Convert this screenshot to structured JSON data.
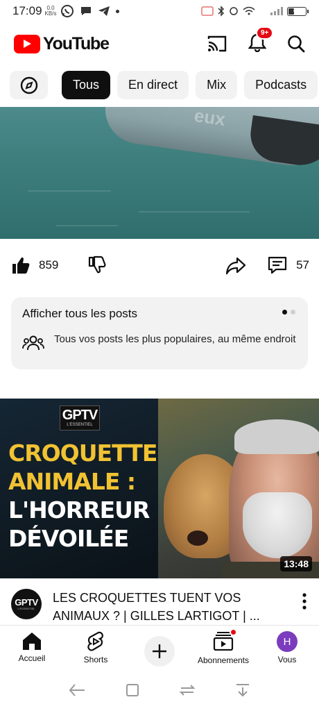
{
  "status_bar": {
    "time": "17:09",
    "net_speed_value": "0.0",
    "net_speed_unit": "KB/s",
    "battery": "6"
  },
  "header": {
    "app_name": "YouTube",
    "notification_badge": "9+"
  },
  "chips": [
    {
      "label": "Tous",
      "selected": true
    },
    {
      "label": "En direct",
      "selected": false
    },
    {
      "label": "Mix",
      "selected": false
    },
    {
      "label": "Podcasts",
      "selected": false
    }
  ],
  "post": {
    "image_overlay_text": "eux",
    "likes": "859",
    "comments": "57"
  },
  "posts_card": {
    "title": "Afficher tous les posts",
    "description": "Tous vos posts les plus populaires, au même endroit"
  },
  "video": {
    "thumbnail_badge_main": "GPTV",
    "thumbnail_badge_sub": "L'ESSENTIEL",
    "headline_line1": "CROQUETTE",
    "headline_line2": "ANIMALE :",
    "headline_line3": "L'HORREUR",
    "headline_line4": "DÉVOILÉE",
    "duration": "13:48",
    "title": "LES CROQUETTES TUENT VOS ANIMAUX ? | GILLES LARTIGOT | ...",
    "channel_avatar_main": "GPTV",
    "channel_avatar_sub": "L'ESSENTIEL"
  },
  "bottom_nav": {
    "home": "Accueil",
    "shorts": "Shorts",
    "subscriptions": "Abonnements",
    "you": "Vous",
    "avatar_letter": "H"
  },
  "colors": {
    "brand_red": "#ff0000",
    "headline_yellow": "#f1c232",
    "avatar_purple": "#7b3cbe"
  }
}
